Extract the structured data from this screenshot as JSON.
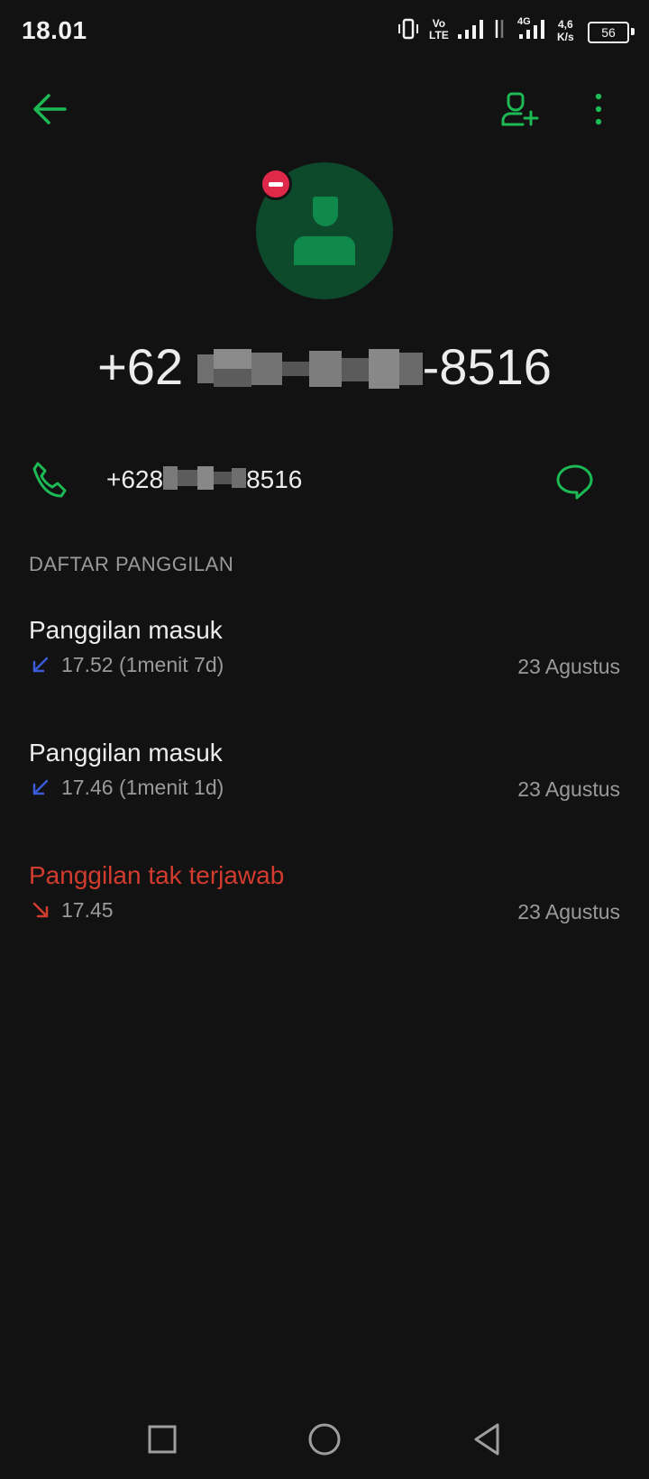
{
  "status_bar": {
    "time": "18.01",
    "network_speed_value": "4,6",
    "network_speed_unit": "K/s",
    "battery": "56",
    "volte_top": "Vo",
    "volte_bottom": "LTE",
    "network_type": "4G"
  },
  "header": {
    "icons": [
      "back-arrow-icon",
      "add-contact-icon",
      "more-vertical-icon"
    ]
  },
  "contact": {
    "number_prefix": "+62",
    "number_suffix": "-8516",
    "blocked": true
  },
  "phone_row": {
    "number_prefix": "+628",
    "number_suffix": "8516"
  },
  "call_log": {
    "section_title": "DAFTAR PANGGILAN",
    "items": [
      {
        "title": "Panggilan masuk",
        "detail": "17.52 (1menit 7d)",
        "date": "23 Agustus",
        "type": "incoming"
      },
      {
        "title": "Panggilan masuk",
        "detail": "17.46 (1menit 1d)",
        "date": "23 Agustus",
        "type": "incoming"
      },
      {
        "title": "Panggilan tak terjawab",
        "detail": "17.45",
        "date": "23 Agustus",
        "type": "missed"
      }
    ]
  },
  "colors": {
    "accent": "#1db954",
    "background": "#121212",
    "missed": "#d23c2f",
    "incoming_arrow": "#3b5ad6",
    "avatar_bg": "#0d4a2c"
  }
}
